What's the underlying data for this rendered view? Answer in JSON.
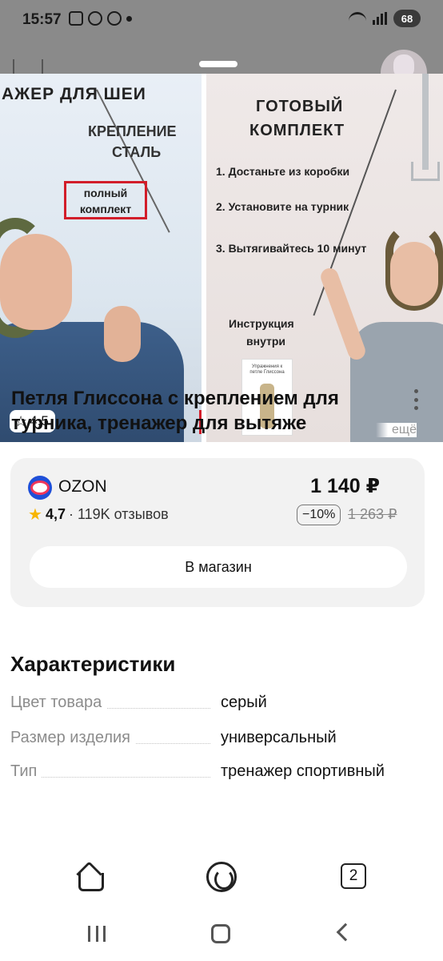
{
  "status_bar": {
    "time": "15:57",
    "battery": "68"
  },
  "gallery": {
    "left_image": {
      "heading": "АЖЕР ДЛЯ ШЕИ",
      "line1": "КРЕПЛЕНИЕ",
      "line2": "СТАЛЬ",
      "boxed_line1": "полный",
      "boxed_line2": "комплект"
    },
    "right_image": {
      "title_line1": "ГОТОВЫЙ",
      "title_line2": "КОМПЛЕКТ",
      "step1": "1. Достаньте из коробки",
      "step2": "2. Установите на турник",
      "step3": "3. Вытягивайтесь 10 минут",
      "instruction_line1": "Инструкция",
      "instruction_line2": "внутри",
      "booklet_text": "Упражнения к петле Глиссона"
    },
    "rating": "4,5"
  },
  "product": {
    "title": "Петля Глиссона с креплением для турника, тренажер для вытяже",
    "more_label": "ещё"
  },
  "offer": {
    "shop_name": "OZON",
    "shop_rating": "4,7",
    "reviews": "· 119K отзывов",
    "price": "1 140 ₽",
    "discount": "−10%",
    "old_price": "1 263 ₽",
    "button_label": "В магазин",
    "colors": {
      "ozon_blue": "#1f4fd8",
      "ozon_pink": "#f0365a",
      "star": "#f7b500"
    }
  },
  "specs": {
    "title": "Характеристики",
    "rows": [
      {
        "key": "Цвет товара",
        "value": "серый"
      },
      {
        "key": "Размер изделия",
        "value": "универсальный"
      },
      {
        "key": "Тип",
        "value": "тренажер спортивный"
      }
    ]
  },
  "bottom_nav": {
    "tabs_count": "2"
  },
  "icons": [
    "cart-icon",
    "star-outline-icon",
    "more-vertical-icon",
    "ozon-logo-icon",
    "star-icon",
    "home-icon",
    "alice-icon",
    "tabs-icon",
    "recent-apps-icon",
    "system-home-icon",
    "back-icon"
  ]
}
